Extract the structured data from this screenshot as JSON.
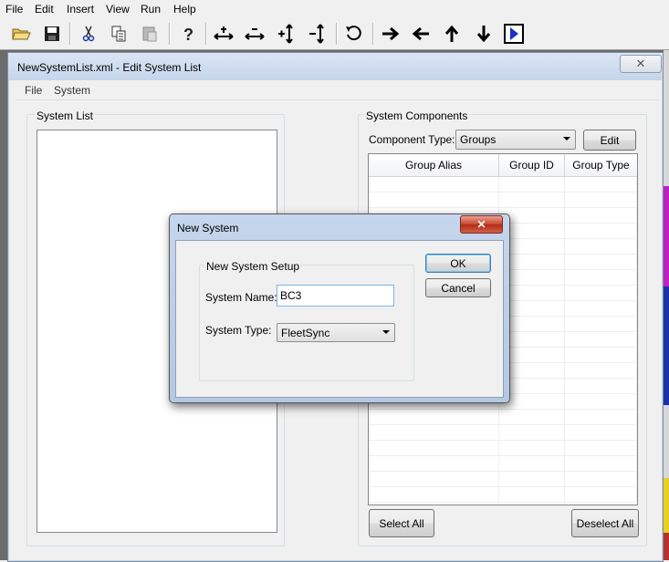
{
  "menu": {
    "file": "File",
    "edit": "Edit",
    "insert": "Insert",
    "view": "View",
    "run": "Run",
    "help": "Help"
  },
  "toolbar": {
    "icons": [
      "open-folder-icon",
      "save-disk-icon",
      "cut-icon",
      "copy-icon",
      "paste-icon",
      "help-icon",
      "add-horizontal-icon",
      "remove-horizontal-icon",
      "add-vertical-icon",
      "remove-vertical-icon",
      "undo-icon",
      "arrow-right-icon",
      "arrow-left-icon",
      "arrow-up-icon",
      "arrow-down-icon",
      "play-icon"
    ]
  },
  "editor": {
    "title": "NewSystemList.xml - Edit System List",
    "close_glyph": "✕",
    "menu": {
      "file": "File",
      "system": "System"
    },
    "system_list_label": "System List",
    "components_label": "System Components",
    "component_type_label": "Component Type:",
    "component_type_value": "Groups",
    "edit_button": "Edit",
    "columns": [
      "Group Alias",
      "Group ID",
      "Group Type"
    ],
    "select_all": "Select All",
    "deselect_all": "Deselect All"
  },
  "dialog": {
    "title": "New System",
    "close_glyph": "✕",
    "group_label": "New System Setup",
    "name_label": "System Name:",
    "name_value": "BC3",
    "type_label": "System Type:",
    "type_value": "FleetSync",
    "ok": "OK",
    "cancel": "Cancel"
  },
  "colors": {
    "accent": "#3399ff",
    "dialog_frame": "#b9cce6",
    "close_red": "#c8442c"
  }
}
